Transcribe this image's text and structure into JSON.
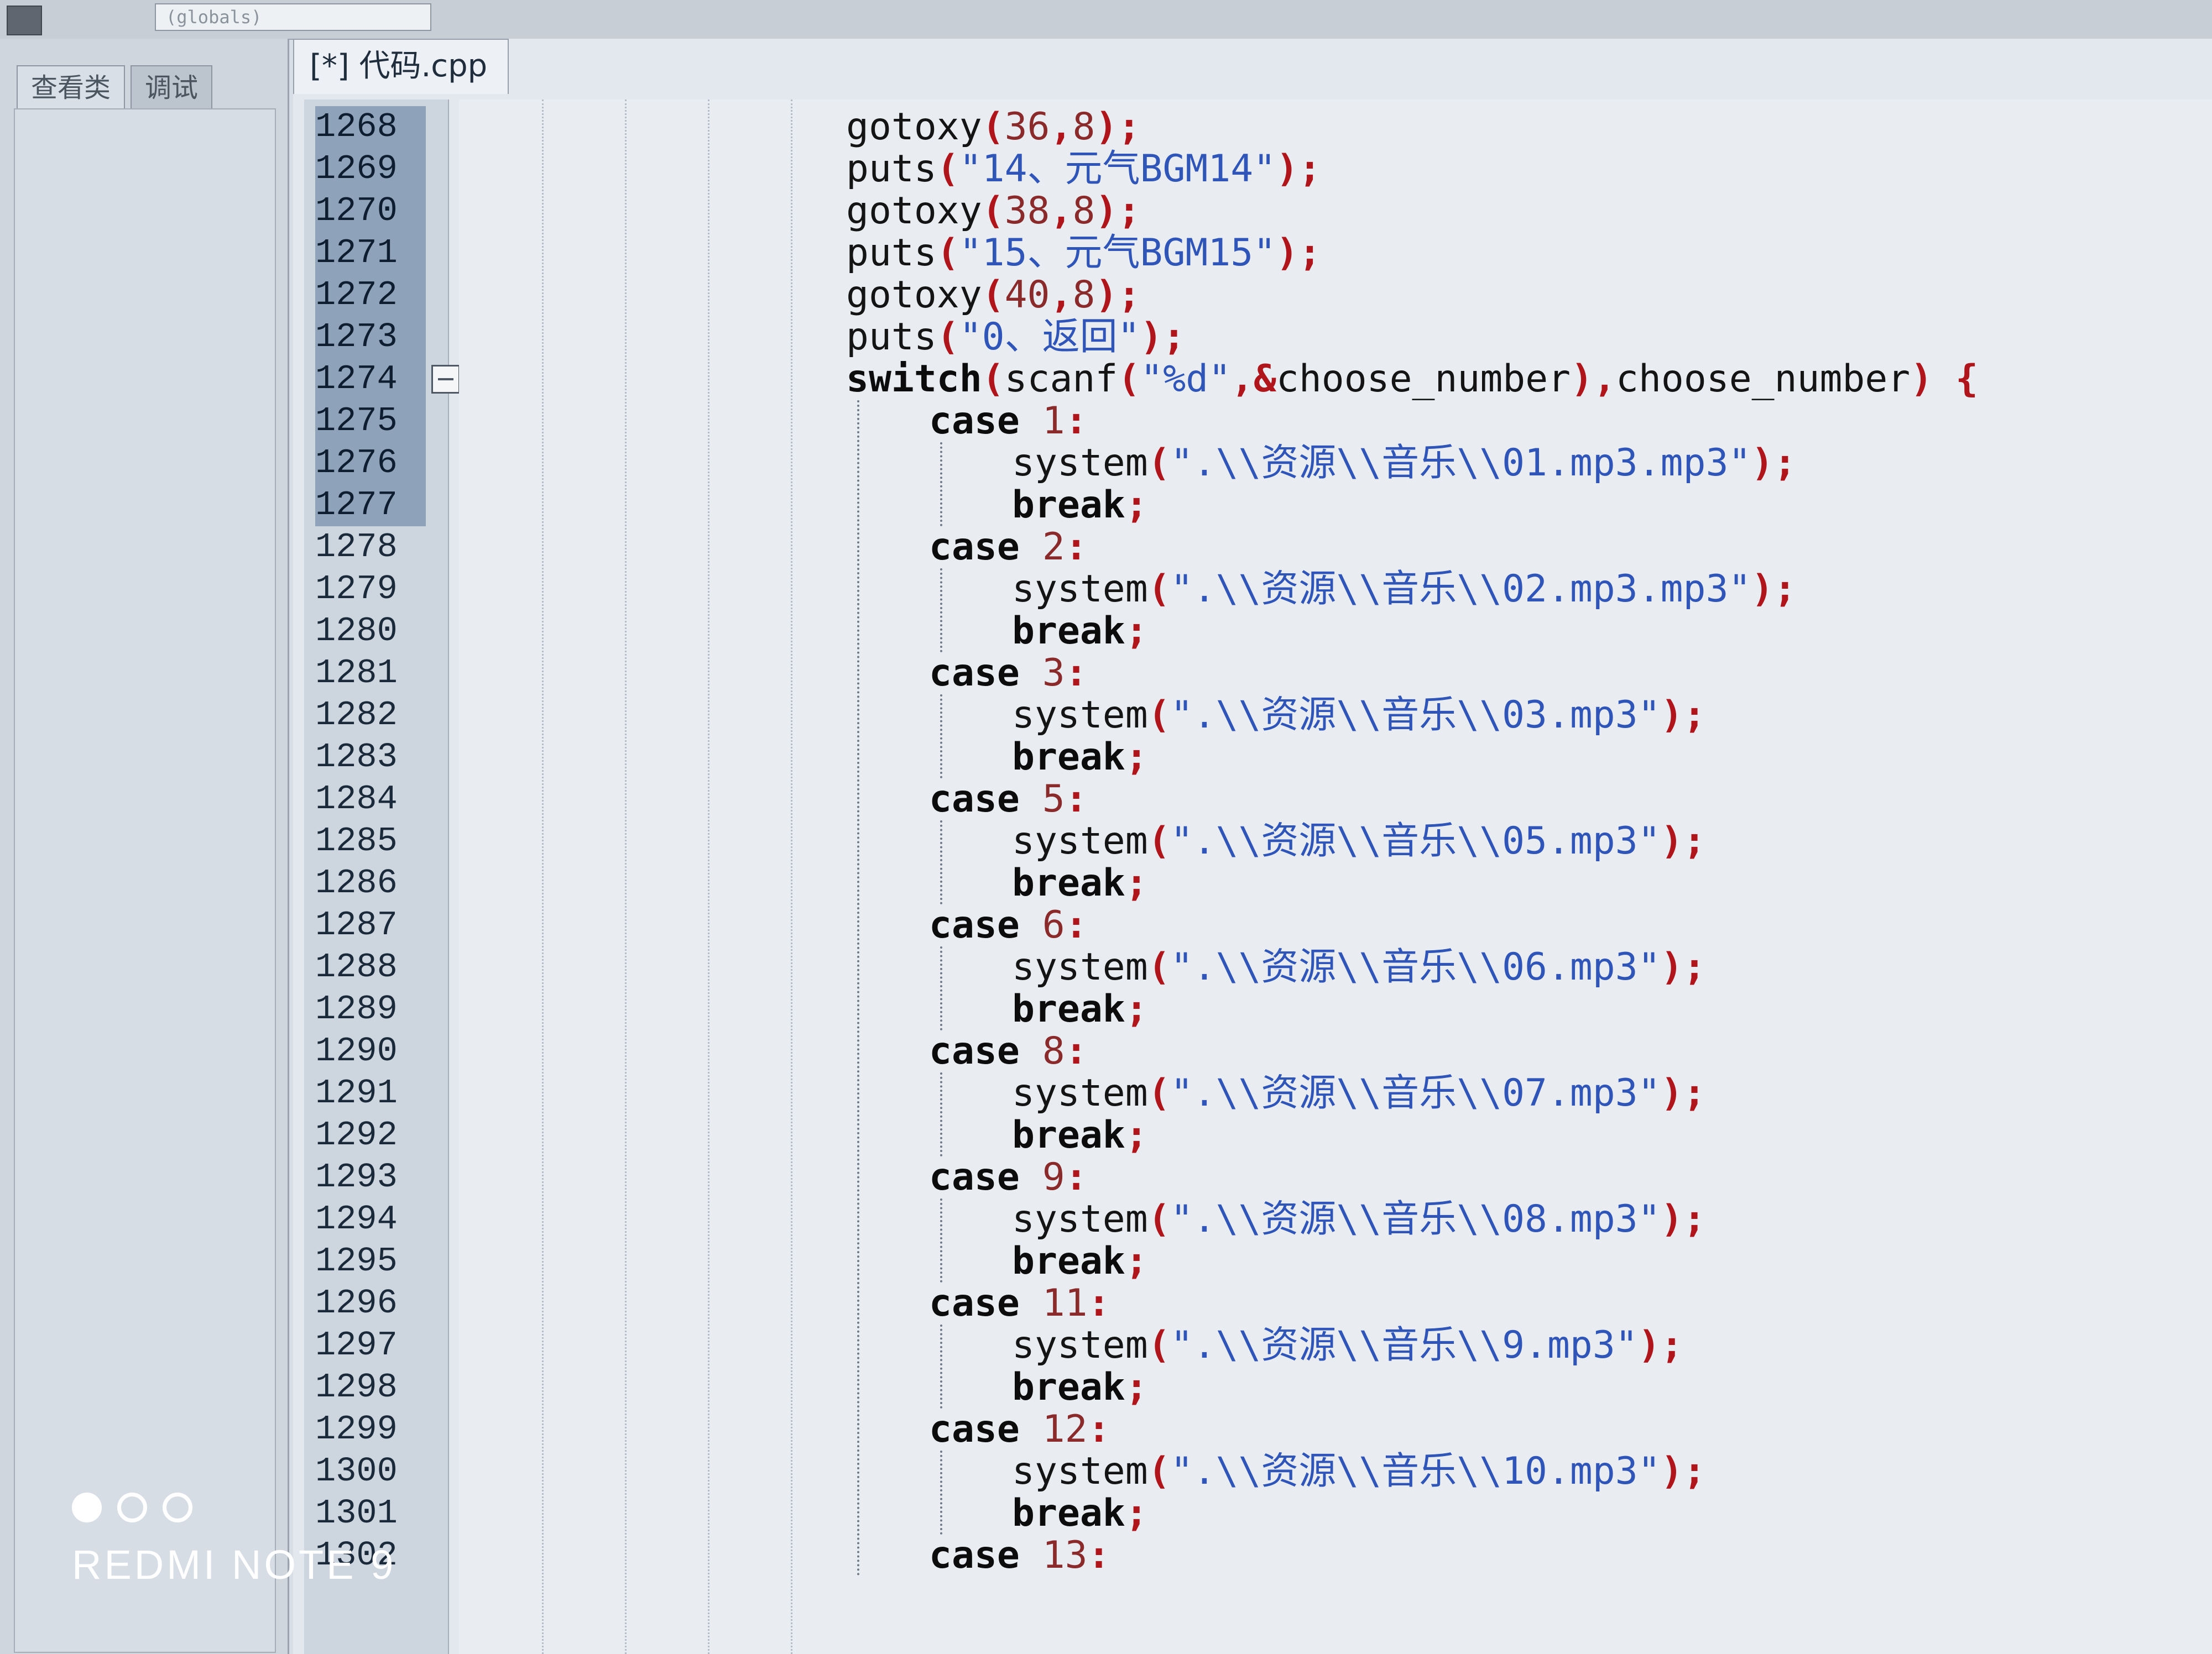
{
  "toolbar": {
    "scope_value": "(globals)"
  },
  "left_panel": {
    "tabs": [
      {
        "label": "查看类"
      },
      {
        "label": "调试"
      }
    ]
  },
  "editor": {
    "tab_label": "[*] 代码.cpp",
    "line_numbers": [
      "1268",
      "1269",
      "1270",
      "1271",
      "1272",
      "1273",
      "1274",
      "1275",
      "1276",
      "1277",
      "1278",
      "1279",
      "1280",
      "1281",
      "1282",
      "1283",
      "1284",
      "1285",
      "1286",
      "1287",
      "1288",
      "1289",
      "1290",
      "1291",
      "1292",
      "1293",
      "1294",
      "1295",
      "1296",
      "1297",
      "1298",
      "1299",
      "1300",
      "1301",
      "1302"
    ],
    "code_lines": [
      {
        "indent": 0,
        "tokens": [
          {
            "t": "gotoxy",
            "c": "fn"
          },
          {
            "t": "(",
            "c": "pn"
          },
          {
            "t": "36",
            "c": "num"
          },
          {
            "t": ",",
            "c": "pn"
          },
          {
            "t": "8",
            "c": "num"
          },
          {
            "t": ");",
            "c": "pn"
          }
        ]
      },
      {
        "indent": 0,
        "tokens": [
          {
            "t": "puts",
            "c": "fn"
          },
          {
            "t": "(",
            "c": "pn"
          },
          {
            "t": "\"14、元气BGM14\"",
            "c": "str"
          },
          {
            "t": ");",
            "c": "pn"
          }
        ]
      },
      {
        "indent": 0,
        "tokens": [
          {
            "t": "gotoxy",
            "c": "fn"
          },
          {
            "t": "(",
            "c": "pn"
          },
          {
            "t": "38",
            "c": "num"
          },
          {
            "t": ",",
            "c": "pn"
          },
          {
            "t": "8",
            "c": "num"
          },
          {
            "t": ");",
            "c": "pn"
          }
        ]
      },
      {
        "indent": 0,
        "tokens": [
          {
            "t": "puts",
            "c": "fn"
          },
          {
            "t": "(",
            "c": "pn"
          },
          {
            "t": "\"15、元气BGM15\"",
            "c": "str"
          },
          {
            "t": ");",
            "c": "pn"
          }
        ]
      },
      {
        "indent": 0,
        "tokens": [
          {
            "t": "gotoxy",
            "c": "fn"
          },
          {
            "t": "(",
            "c": "pn"
          },
          {
            "t": "40",
            "c": "num"
          },
          {
            "t": ",",
            "c": "pn"
          },
          {
            "t": "8",
            "c": "num"
          },
          {
            "t": ");",
            "c": "pn"
          }
        ]
      },
      {
        "indent": 0,
        "tokens": [
          {
            "t": "puts",
            "c": "fn"
          },
          {
            "t": "(",
            "c": "pn"
          },
          {
            "t": "\"0、返回\"",
            "c": "str"
          },
          {
            "t": ");",
            "c": "pn"
          }
        ]
      },
      {
        "indent": 0,
        "tokens": [
          {
            "t": "switch",
            "c": "kw"
          },
          {
            "t": "(",
            "c": "pn"
          },
          {
            "t": "scanf",
            "c": "fn"
          },
          {
            "t": "(",
            "c": "pn"
          },
          {
            "t": "\"%d\"",
            "c": "str"
          },
          {
            "t": ",&",
            "c": "pn"
          },
          {
            "t": "choose_number",
            "c": "fn"
          },
          {
            "t": "),",
            "c": "pn"
          },
          {
            "t": "choose_number",
            "c": "fn"
          },
          {
            "t": ") {",
            "c": "pn"
          }
        ]
      },
      {
        "indent": 1,
        "tokens": [
          {
            "t": "case ",
            "c": "kw"
          },
          {
            "t": "1",
            "c": "num"
          },
          {
            "t": ":",
            "c": "pn"
          }
        ]
      },
      {
        "indent": 2,
        "tokens": [
          {
            "t": "system",
            "c": "fn"
          },
          {
            "t": "(",
            "c": "pn"
          },
          {
            "t": "\".\\\\资源\\\\音乐\\\\01.mp3.mp3\"",
            "c": "str"
          },
          {
            "t": ");",
            "c": "pn"
          }
        ]
      },
      {
        "indent": 2,
        "tokens": [
          {
            "t": "break",
            "c": "kw"
          },
          {
            "t": ";",
            "c": "pn"
          }
        ]
      },
      {
        "indent": 1,
        "tokens": [
          {
            "t": "case ",
            "c": "kw"
          },
          {
            "t": "2",
            "c": "num"
          },
          {
            "t": ":",
            "c": "pn"
          }
        ]
      },
      {
        "indent": 2,
        "tokens": [
          {
            "t": "system",
            "c": "fn"
          },
          {
            "t": "(",
            "c": "pn"
          },
          {
            "t": "\".\\\\资源\\\\音乐\\\\02.mp3.mp3\"",
            "c": "str"
          },
          {
            "t": ");",
            "c": "pn"
          }
        ]
      },
      {
        "indent": 2,
        "tokens": [
          {
            "t": "break",
            "c": "kw"
          },
          {
            "t": ";",
            "c": "pn"
          }
        ]
      },
      {
        "indent": 1,
        "tokens": [
          {
            "t": "case ",
            "c": "kw"
          },
          {
            "t": "3",
            "c": "num"
          },
          {
            "t": ":",
            "c": "pn"
          }
        ]
      },
      {
        "indent": 2,
        "tokens": [
          {
            "t": "system",
            "c": "fn"
          },
          {
            "t": "(",
            "c": "pn"
          },
          {
            "t": "\".\\\\资源\\\\音乐\\\\03.mp3\"",
            "c": "str"
          },
          {
            "t": ");",
            "c": "pn"
          }
        ]
      },
      {
        "indent": 2,
        "tokens": [
          {
            "t": "break",
            "c": "kw"
          },
          {
            "t": ";",
            "c": "pn"
          }
        ]
      },
      {
        "indent": 1,
        "tokens": [
          {
            "t": "case ",
            "c": "kw"
          },
          {
            "t": "5",
            "c": "num"
          },
          {
            "t": ":",
            "c": "pn"
          }
        ]
      },
      {
        "indent": 2,
        "tokens": [
          {
            "t": "system",
            "c": "fn"
          },
          {
            "t": "(",
            "c": "pn"
          },
          {
            "t": "\".\\\\资源\\\\音乐\\\\05.mp3\"",
            "c": "str"
          },
          {
            "t": ");",
            "c": "pn"
          }
        ]
      },
      {
        "indent": 2,
        "tokens": [
          {
            "t": "break",
            "c": "kw"
          },
          {
            "t": ";",
            "c": "pn"
          }
        ]
      },
      {
        "indent": 1,
        "tokens": [
          {
            "t": "case ",
            "c": "kw"
          },
          {
            "t": "6",
            "c": "num"
          },
          {
            "t": ":",
            "c": "pn"
          }
        ]
      },
      {
        "indent": 2,
        "tokens": [
          {
            "t": "system",
            "c": "fn"
          },
          {
            "t": "(",
            "c": "pn"
          },
          {
            "t": "\".\\\\资源\\\\音乐\\\\06.mp3\"",
            "c": "str"
          },
          {
            "t": ");",
            "c": "pn"
          }
        ]
      },
      {
        "indent": 2,
        "tokens": [
          {
            "t": "break",
            "c": "kw"
          },
          {
            "t": ";",
            "c": "pn"
          }
        ]
      },
      {
        "indent": 1,
        "tokens": [
          {
            "t": "case ",
            "c": "kw"
          },
          {
            "t": "8",
            "c": "num"
          },
          {
            "t": ":",
            "c": "pn"
          }
        ]
      },
      {
        "indent": 2,
        "tokens": [
          {
            "t": "system",
            "c": "fn"
          },
          {
            "t": "(",
            "c": "pn"
          },
          {
            "t": "\".\\\\资源\\\\音乐\\\\07.mp3\"",
            "c": "str"
          },
          {
            "t": ");",
            "c": "pn"
          }
        ]
      },
      {
        "indent": 2,
        "tokens": [
          {
            "t": "break",
            "c": "kw"
          },
          {
            "t": ";",
            "c": "pn"
          }
        ]
      },
      {
        "indent": 1,
        "tokens": [
          {
            "t": "case ",
            "c": "kw"
          },
          {
            "t": "9",
            "c": "num"
          },
          {
            "t": ":",
            "c": "pn"
          }
        ]
      },
      {
        "indent": 2,
        "tokens": [
          {
            "t": "system",
            "c": "fn"
          },
          {
            "t": "(",
            "c": "pn"
          },
          {
            "t": "\".\\\\资源\\\\音乐\\\\08.mp3\"",
            "c": "str"
          },
          {
            "t": ");",
            "c": "pn"
          }
        ]
      },
      {
        "indent": 2,
        "tokens": [
          {
            "t": "break",
            "c": "kw"
          },
          {
            "t": ";",
            "c": "pn"
          }
        ]
      },
      {
        "indent": 1,
        "tokens": [
          {
            "t": "case ",
            "c": "kw"
          },
          {
            "t": "11",
            "c": "num"
          },
          {
            "t": ":",
            "c": "pn"
          }
        ]
      },
      {
        "indent": 2,
        "tokens": [
          {
            "t": "system",
            "c": "fn"
          },
          {
            "t": "(",
            "c": "pn"
          },
          {
            "t": "\".\\\\资源\\\\音乐\\\\9.mp3\"",
            "c": "str"
          },
          {
            "t": ");",
            "c": "pn"
          }
        ]
      },
      {
        "indent": 2,
        "tokens": [
          {
            "t": "break",
            "c": "kw"
          },
          {
            "t": ";",
            "c": "pn"
          }
        ]
      },
      {
        "indent": 1,
        "tokens": [
          {
            "t": "case ",
            "c": "kw"
          },
          {
            "t": "12",
            "c": "num"
          },
          {
            "t": ":",
            "c": "pn"
          }
        ]
      },
      {
        "indent": 2,
        "tokens": [
          {
            "t": "system",
            "c": "fn"
          },
          {
            "t": "(",
            "c": "pn"
          },
          {
            "t": "\".\\\\资源\\\\音乐\\\\10.mp3\"",
            "c": "str"
          },
          {
            "t": ");",
            "c": "pn"
          }
        ]
      },
      {
        "indent": 2,
        "tokens": [
          {
            "t": "break",
            "c": "kw"
          },
          {
            "t": ";",
            "c": "pn"
          }
        ]
      },
      {
        "indent": 1,
        "tokens": [
          {
            "t": "case ",
            "c": "kw"
          },
          {
            "t": "13",
            "c": "num"
          },
          {
            "t": ":",
            "c": "pn"
          }
        ]
      }
    ]
  },
  "watermark": {
    "text": "REDMI NOTE 9"
  }
}
